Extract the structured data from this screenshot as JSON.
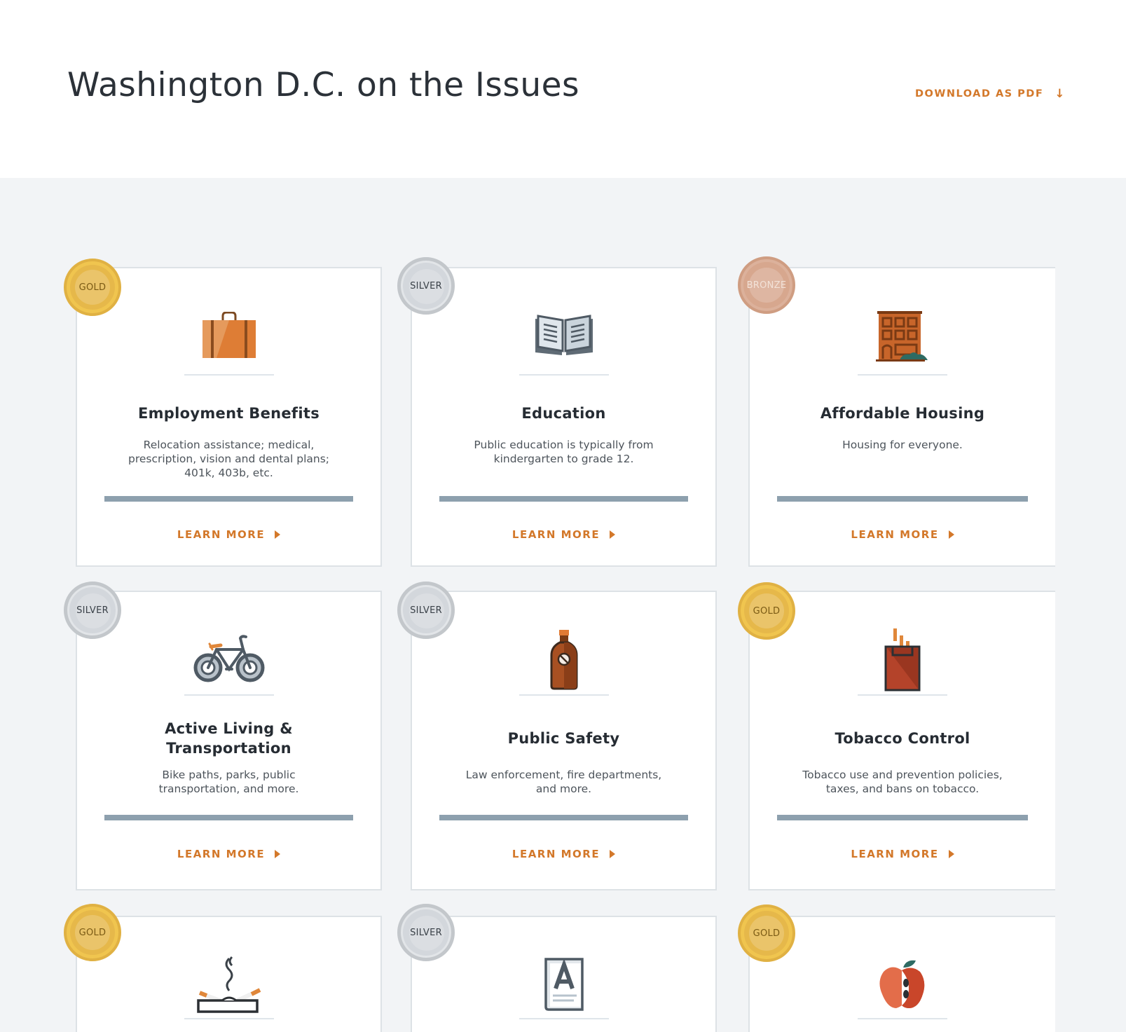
{
  "header": {
    "title": "Washington D.C. on the Issues",
    "download_label": "DOWNLOAD AS PDF",
    "download_arrow": "↓"
  },
  "colors": {
    "accent": "#d3782a",
    "background": "#f2f4f6",
    "bar": "#8da0ae",
    "gold": "#e6b84a",
    "silver": "#d3d7dc",
    "bronze": "#d7a78e"
  },
  "cards": [
    {
      "medal": "GOLD",
      "icon": "briefcase-icon",
      "title": "Employment Benefits",
      "desc_lines": [
        "Relocation assistance; medical,",
        "prescription, vision and dental plans;",
        "401k, 403b, etc."
      ],
      "learn": "LEARN MORE"
    },
    {
      "medal": "SILVER",
      "icon": "book-icon",
      "title": "Education",
      "desc_lines": [
        "Public education is typically from",
        "kindergarten to grade 12."
      ],
      "learn": "LEARN MORE"
    },
    {
      "medal": "BRONZE",
      "icon": "building-icon",
      "title": "Affordable Housing",
      "desc_lines": [
        "Housing for everyone."
      ],
      "learn": "LEARN MORE"
    },
    {
      "medal": "SILVER",
      "icon": "bicycle-icon",
      "title_lines": [
        "Active Living &",
        "Transportation"
      ],
      "desc_lines": [
        "Bike paths, parks, public",
        "transportation, and more."
      ],
      "learn": "LEARN MORE"
    },
    {
      "medal": "SILVER",
      "icon": "bottle-icon",
      "title": "Public Safety",
      "desc_lines": [
        "Law enforcement, fire departments,",
        "and more."
      ],
      "learn": "LEARN MORE"
    },
    {
      "medal": "GOLD",
      "icon": "cigarette-pack-icon",
      "title": "Tobacco Control",
      "desc_lines": [
        "Tobacco use and prevention policies,",
        "taxes, and bans on tobacco."
      ],
      "learn": "LEARN MORE"
    },
    {
      "medal": "GOLD",
      "icon": "ashtray-icon"
    },
    {
      "medal": "SILVER",
      "icon": "document-a-icon"
    },
    {
      "medal": "GOLD",
      "icon": "apple-icon"
    }
  ]
}
